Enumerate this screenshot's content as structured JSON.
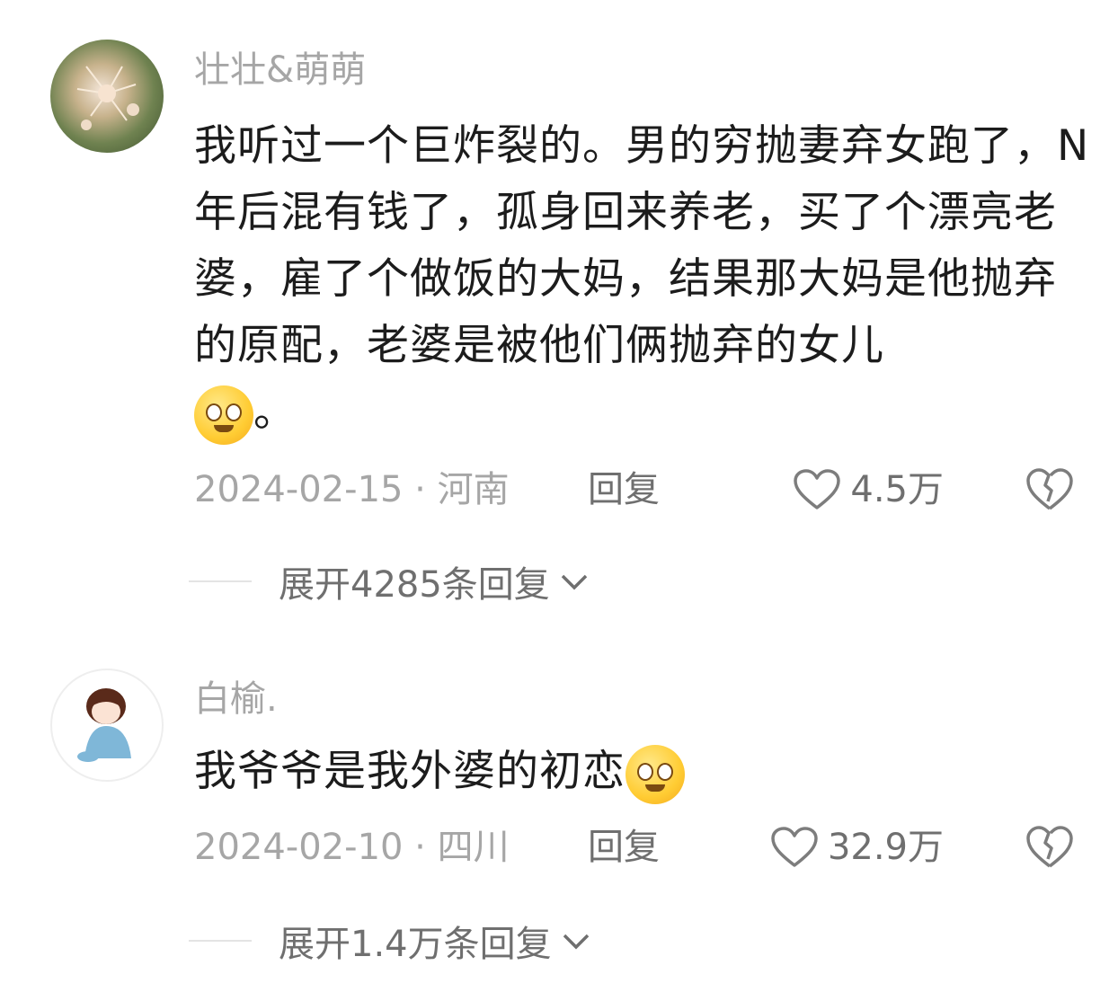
{
  "comments": [
    {
      "username": "壮壮&萌萌",
      "avatar_icon": "flower-avatar",
      "text": "我听过一个巨炸裂的。男的穷抛妻弃女跑了，N年后混有钱了，孤身回来养老，买了个漂亮老婆，雇了个做饭的大妈，结果那大妈是他抛弃的原配，老婆是被他们俩抛弃的女儿",
      "emoji": "shocked-emoji",
      "text_suffix": "。",
      "date_location": "2024-02-15 · 河南",
      "reply_label": "回复",
      "like_count": "4.5万",
      "expand_label": "展开4285条回复"
    },
    {
      "username": "白榆.",
      "avatar_icon": "anime-boy-avatar",
      "text": "我爷爷是我外婆的初恋",
      "emoji": "thinking-emoji",
      "date_location": "2024-02-10 · 四川",
      "reply_label": "回复",
      "like_count": "32.9万",
      "expand_label": "展开1.4万条回复"
    }
  ],
  "colors": {
    "username": "#a6a6a6",
    "text": "#1c1c1c",
    "meta": "#a6a6a6",
    "action": "#6f6f6f"
  }
}
